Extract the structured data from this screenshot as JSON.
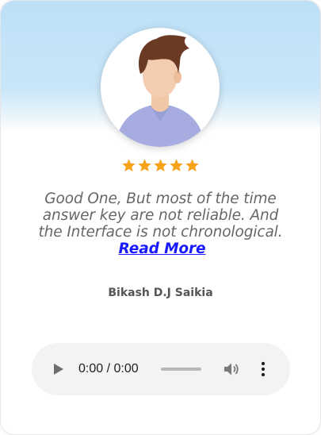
{
  "testimonial": {
    "rating": 5,
    "rating_max": 5,
    "review_text": "Good One, But most of the time answer key are not reliable. And the Interface is not chronological.",
    "read_more_label": "Read More",
    "author": "Bikash D.J Saikia"
  },
  "audio_player": {
    "time_display": "0:00 / 0:00",
    "progress": 0
  },
  "colors": {
    "star": "#f7a21b",
    "link": "#1a1aff",
    "card_top": "#bde0f7",
    "audio_bg": "#f1f3f4"
  },
  "icons": {
    "avatar": "avatar-icon",
    "star": "star-icon",
    "play": "play-icon",
    "volume": "volume-icon",
    "more": "more-vertical-icon"
  }
}
